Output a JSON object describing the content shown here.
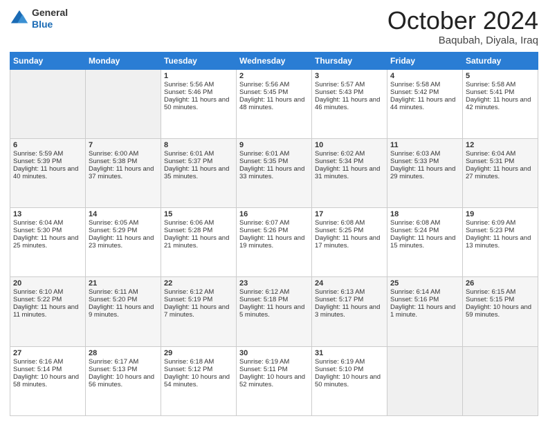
{
  "header": {
    "logo_line1": "General",
    "logo_line2": "Blue",
    "month": "October 2024",
    "location": "Baqubah, Diyala, Iraq"
  },
  "days_of_week": [
    "Sunday",
    "Monday",
    "Tuesday",
    "Wednesday",
    "Thursday",
    "Friday",
    "Saturday"
  ],
  "weeks": [
    [
      {
        "day": "",
        "info": ""
      },
      {
        "day": "",
        "info": ""
      },
      {
        "day": "1",
        "info": "Sunrise: 5:56 AM\nSunset: 5:46 PM\nDaylight: 11 hours and 50 minutes."
      },
      {
        "day": "2",
        "info": "Sunrise: 5:56 AM\nSunset: 5:45 PM\nDaylight: 11 hours and 48 minutes."
      },
      {
        "day": "3",
        "info": "Sunrise: 5:57 AM\nSunset: 5:43 PM\nDaylight: 11 hours and 46 minutes."
      },
      {
        "day": "4",
        "info": "Sunrise: 5:58 AM\nSunset: 5:42 PM\nDaylight: 11 hours and 44 minutes."
      },
      {
        "day": "5",
        "info": "Sunrise: 5:58 AM\nSunset: 5:41 PM\nDaylight: 11 hours and 42 minutes."
      }
    ],
    [
      {
        "day": "6",
        "info": "Sunrise: 5:59 AM\nSunset: 5:39 PM\nDaylight: 11 hours and 40 minutes."
      },
      {
        "day": "7",
        "info": "Sunrise: 6:00 AM\nSunset: 5:38 PM\nDaylight: 11 hours and 37 minutes."
      },
      {
        "day": "8",
        "info": "Sunrise: 6:01 AM\nSunset: 5:37 PM\nDaylight: 11 hours and 35 minutes."
      },
      {
        "day": "9",
        "info": "Sunrise: 6:01 AM\nSunset: 5:35 PM\nDaylight: 11 hours and 33 minutes."
      },
      {
        "day": "10",
        "info": "Sunrise: 6:02 AM\nSunset: 5:34 PM\nDaylight: 11 hours and 31 minutes."
      },
      {
        "day": "11",
        "info": "Sunrise: 6:03 AM\nSunset: 5:33 PM\nDaylight: 11 hours and 29 minutes."
      },
      {
        "day": "12",
        "info": "Sunrise: 6:04 AM\nSunset: 5:31 PM\nDaylight: 11 hours and 27 minutes."
      }
    ],
    [
      {
        "day": "13",
        "info": "Sunrise: 6:04 AM\nSunset: 5:30 PM\nDaylight: 11 hours and 25 minutes."
      },
      {
        "day": "14",
        "info": "Sunrise: 6:05 AM\nSunset: 5:29 PM\nDaylight: 11 hours and 23 minutes."
      },
      {
        "day": "15",
        "info": "Sunrise: 6:06 AM\nSunset: 5:28 PM\nDaylight: 11 hours and 21 minutes."
      },
      {
        "day": "16",
        "info": "Sunrise: 6:07 AM\nSunset: 5:26 PM\nDaylight: 11 hours and 19 minutes."
      },
      {
        "day": "17",
        "info": "Sunrise: 6:08 AM\nSunset: 5:25 PM\nDaylight: 11 hours and 17 minutes."
      },
      {
        "day": "18",
        "info": "Sunrise: 6:08 AM\nSunset: 5:24 PM\nDaylight: 11 hours and 15 minutes."
      },
      {
        "day": "19",
        "info": "Sunrise: 6:09 AM\nSunset: 5:23 PM\nDaylight: 11 hours and 13 minutes."
      }
    ],
    [
      {
        "day": "20",
        "info": "Sunrise: 6:10 AM\nSunset: 5:22 PM\nDaylight: 11 hours and 11 minutes."
      },
      {
        "day": "21",
        "info": "Sunrise: 6:11 AM\nSunset: 5:20 PM\nDaylight: 11 hours and 9 minutes."
      },
      {
        "day": "22",
        "info": "Sunrise: 6:12 AM\nSunset: 5:19 PM\nDaylight: 11 hours and 7 minutes."
      },
      {
        "day": "23",
        "info": "Sunrise: 6:12 AM\nSunset: 5:18 PM\nDaylight: 11 hours and 5 minutes."
      },
      {
        "day": "24",
        "info": "Sunrise: 6:13 AM\nSunset: 5:17 PM\nDaylight: 11 hours and 3 minutes."
      },
      {
        "day": "25",
        "info": "Sunrise: 6:14 AM\nSunset: 5:16 PM\nDaylight: 11 hours and 1 minute."
      },
      {
        "day": "26",
        "info": "Sunrise: 6:15 AM\nSunset: 5:15 PM\nDaylight: 10 hours and 59 minutes."
      }
    ],
    [
      {
        "day": "27",
        "info": "Sunrise: 6:16 AM\nSunset: 5:14 PM\nDaylight: 10 hours and 58 minutes."
      },
      {
        "day": "28",
        "info": "Sunrise: 6:17 AM\nSunset: 5:13 PM\nDaylight: 10 hours and 56 minutes."
      },
      {
        "day": "29",
        "info": "Sunrise: 6:18 AM\nSunset: 5:12 PM\nDaylight: 10 hours and 54 minutes."
      },
      {
        "day": "30",
        "info": "Sunrise: 6:19 AM\nSunset: 5:11 PM\nDaylight: 10 hours and 52 minutes."
      },
      {
        "day": "31",
        "info": "Sunrise: 6:19 AM\nSunset: 5:10 PM\nDaylight: 10 hours and 50 minutes."
      },
      {
        "day": "",
        "info": ""
      },
      {
        "day": "",
        "info": ""
      }
    ]
  ]
}
